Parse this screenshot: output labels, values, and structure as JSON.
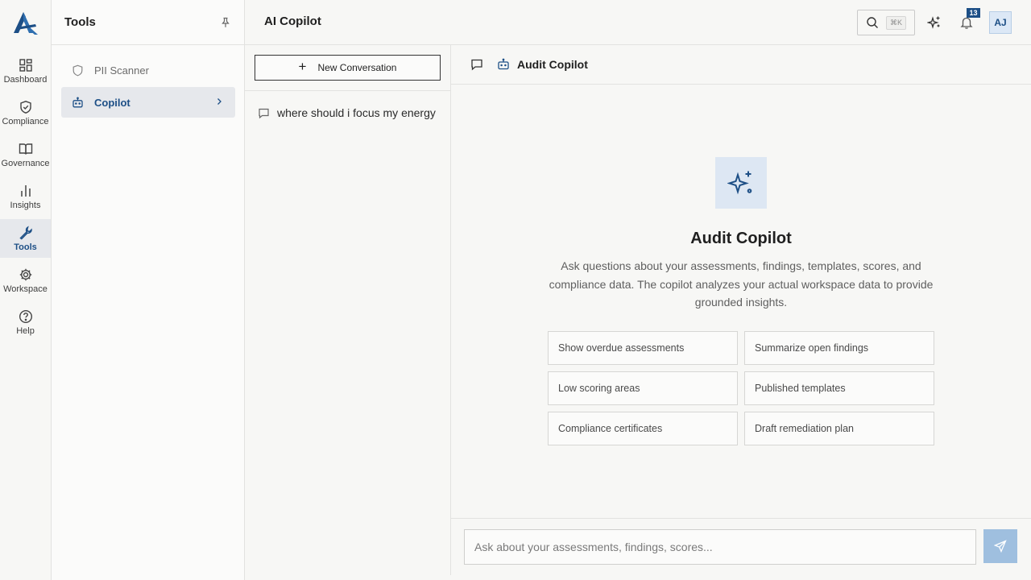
{
  "rail": {
    "logo": "app-logo",
    "items": [
      {
        "label": "Dashboard",
        "icon": "grid-icon"
      },
      {
        "label": "Compliance",
        "icon": "shield-check-icon"
      },
      {
        "label": "Governance",
        "icon": "book-icon"
      },
      {
        "label": "Insights",
        "icon": "bar-chart-icon"
      },
      {
        "label": "Tools",
        "icon": "wrench-icon",
        "active": true
      },
      {
        "label": "Workspace",
        "icon": "gear-icon"
      },
      {
        "label": "Help",
        "icon": "help-circle-icon"
      }
    ]
  },
  "tools_panel": {
    "title": "Tools",
    "items": [
      {
        "label": "PII Scanner",
        "icon": "shield-icon"
      },
      {
        "label": "Copilot",
        "icon": "bot-icon",
        "active": true
      }
    ]
  },
  "header": {
    "title": "AI Copilot",
    "search_shortcut": "⌘K",
    "notification_count": "13",
    "avatar_initials": "AJ"
  },
  "conversations": {
    "new_label": "New Conversation",
    "items": [
      {
        "label": "where should i focus my energy"
      }
    ]
  },
  "chat": {
    "header_title": "Audit Copilot",
    "hero_title": "Audit Copilot",
    "hero_description": "Ask questions about your assessments, findings, templates, scores, and compliance data. The copilot analyzes your actual workspace data to provide grounded insights.",
    "suggestions": [
      "Show overdue assessments",
      "Summarize open findings",
      "Low scoring areas",
      "Published templates",
      "Compliance certificates",
      "Draft remediation plan"
    ],
    "input_placeholder": "Ask about your assessments, findings, scores..."
  },
  "colors": {
    "accent": "#1d4f86",
    "active_bg": "#e6e8ec",
    "send_button": "#9fbfdf"
  }
}
